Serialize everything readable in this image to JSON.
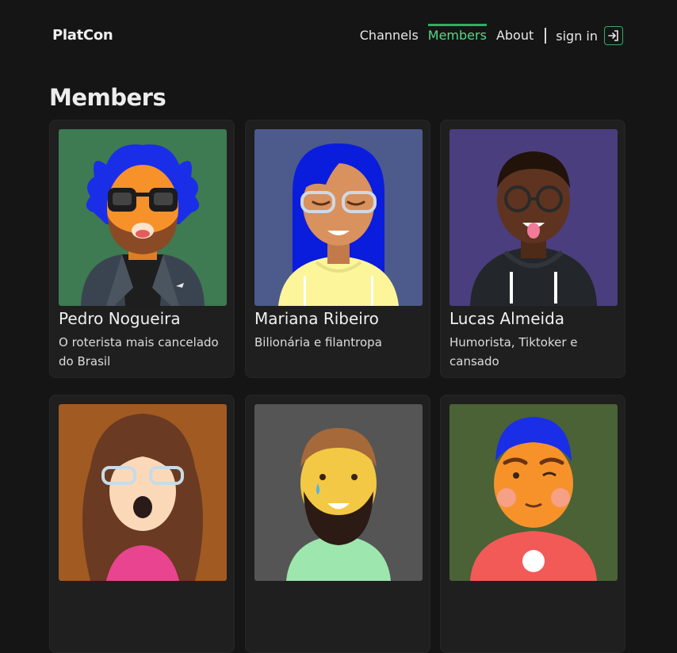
{
  "brand": {
    "name": "PlatCon"
  },
  "nav": {
    "links": [
      {
        "label": "Channels",
        "active": false
      },
      {
        "label": "Members",
        "active": true
      },
      {
        "label": "About",
        "active": false
      }
    ],
    "signin_label": "sign in",
    "signin_icon": "login-icon",
    "accent": "#2fae64"
  },
  "page": {
    "title": "Members"
  },
  "members": [
    {
      "name": "Pedro Nogueira",
      "description": "O roterista mais cancelado do Brasil",
      "avatar_bg": "#3e7a52"
    },
    {
      "name": "Mariana Ribeiro",
      "description": "Bilionária e filantropa",
      "avatar_bg": "#4c5a8c"
    },
    {
      "name": "Lucas Almeida",
      "description": "Humorista, Tiktoker e cansado",
      "avatar_bg": "#4a3e7e"
    },
    {
      "name": "",
      "description": "",
      "avatar_bg": "#a05a22"
    },
    {
      "name": "",
      "description": "",
      "avatar_bg": "#555555"
    },
    {
      "name": "",
      "description": "",
      "avatar_bg": "#4a6236"
    }
  ]
}
